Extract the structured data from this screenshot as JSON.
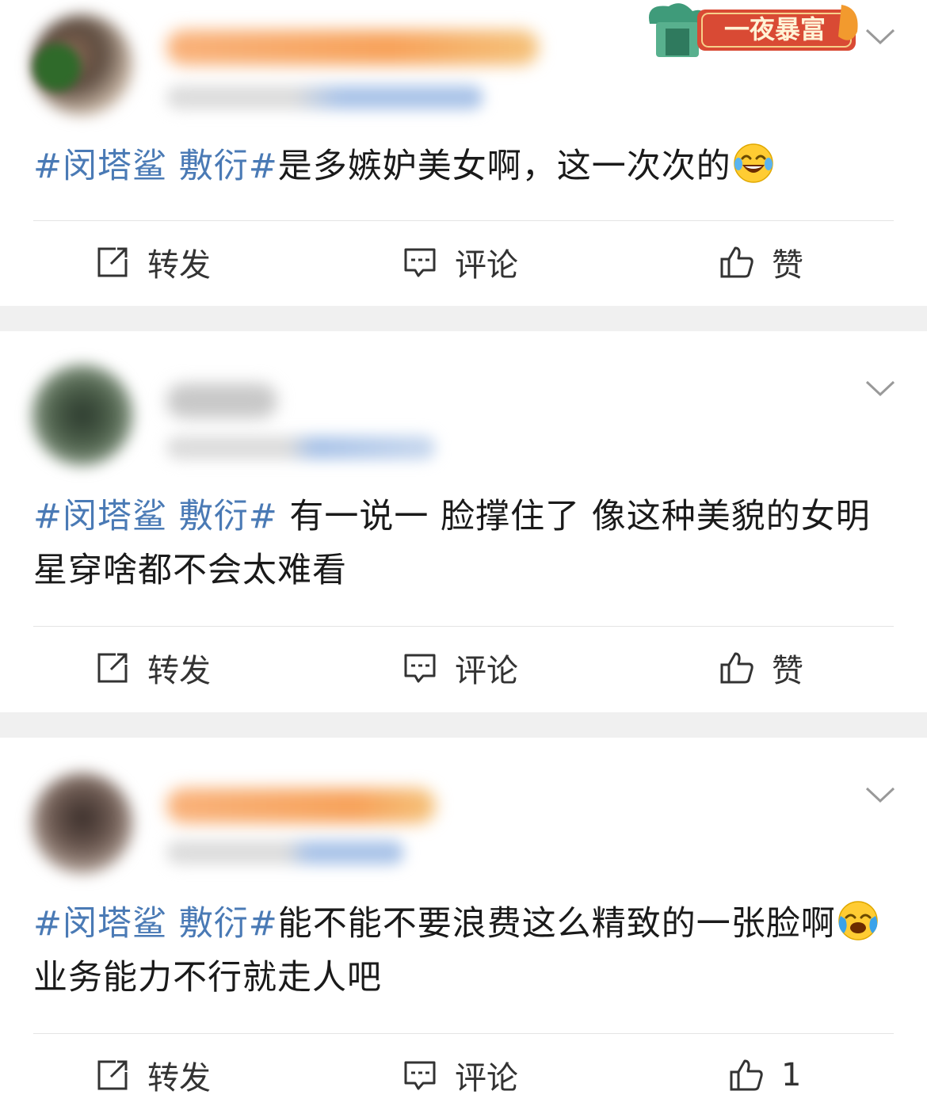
{
  "colors": {
    "hashtag": "#4a7ab5",
    "text": "#1a1a1a",
    "action_text": "#333333",
    "separator": "#f0f0f0",
    "username_blur": "#f7a25a"
  },
  "posts": [
    {
      "badge_text": "一夜暴富",
      "hashtag": "#闵塔鲨 敷衍#",
      "text_before_emoji": "是多嫉妒美女啊，这一次次的",
      "emoji": "laughing-tears-emoji",
      "text_after_emoji": "",
      "actions": {
        "repost": "转发",
        "comment": "评论",
        "like": "赞"
      }
    },
    {
      "hashtag": "#闵塔鲨 敷衍#",
      "text_before_emoji": " 有一说一 脸撑住了 像这种美貌的女明星穿啥都不会太难看",
      "emoji": "",
      "text_after_emoji": "",
      "actions": {
        "repost": "转发",
        "comment": "评论",
        "like": "赞"
      }
    },
    {
      "hashtag": "#闵塔鲨 敷衍#",
      "text_before_emoji": "能不能不要浪费这么精致的一张脸啊",
      "emoji": "crying-laughing-emoji",
      "text_after_emoji": "业务能力不行就走人吧",
      "actions": {
        "repost": "转发",
        "comment": "评论",
        "like": "1"
      }
    }
  ]
}
